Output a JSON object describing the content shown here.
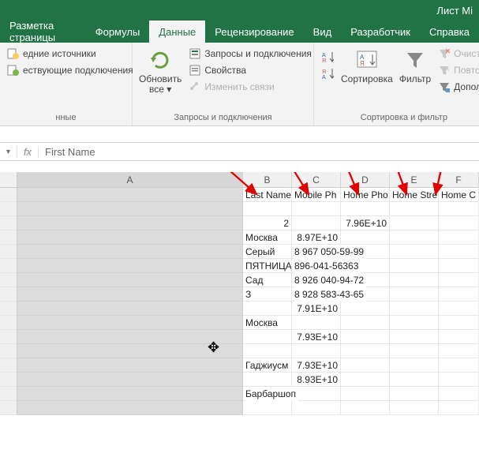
{
  "titlebar": {
    "filename": "Лист Mi"
  },
  "tabs": {
    "layout": "Разметка страницы",
    "formulas": "Формулы",
    "data": "Данные",
    "review": "Рецензирование",
    "view": "Вид",
    "developer": "Разработчик",
    "help": "Справка"
  },
  "ribbon": {
    "sources1": "едние источники",
    "sources2": "ествующие подключения",
    "sources_group": "нные",
    "refresh": "Обновить\nвсе ▾",
    "queries": "Запросы и подключения",
    "properties": "Свойства",
    "edit_links": "Изменить связи",
    "queries_group": "Запросы и подключения",
    "sort_az_tip": "А↓Я",
    "sort_za_tip": "Я↓А",
    "sort": "Сортировка",
    "filter": "Фильтр",
    "clear": "Очист",
    "reapply": "Повто",
    "advanced": "Дополн",
    "sort_group": "Сортировка и фильтр"
  },
  "formula_bar": {
    "fx": "fx",
    "value": "First Name"
  },
  "columns": {
    "A": "A",
    "B": "B",
    "C": "C",
    "D": "D",
    "E": "E",
    "F": "F"
  },
  "headers": {
    "B": "Last Name",
    "C": "Mobile Ph",
    "D": "Home Pho",
    "E": "Home Stre",
    "F": "Home C"
  },
  "rows": [
    {
      "B": "",
      "C": "",
      "D": "",
      "E": ""
    },
    {
      "B": "2",
      "Bnum": true,
      "C": "",
      "D": "7.96E+10",
      "Dnum": true,
      "E": ""
    },
    {
      "B": "Москва",
      "C": "8.97E+10",
      "Cnum": true,
      "D": "",
      "E": ""
    },
    {
      "B": "Серый",
      "C": "8 967 050-59-99",
      "Cover": true,
      "D": "",
      "E": ""
    },
    {
      "B": "ПЯТНИЦА",
      "C": "896-041-56363",
      "Cover": true,
      "D": "",
      "E": ""
    },
    {
      "B": "Сад",
      "C": "8 926 040-94-72",
      "Cover": true,
      "D": "",
      "E": ""
    },
    {
      "B": "З",
      "C": "8 928 583-43-65",
      "Cover": true,
      "D": "",
      "E": ""
    },
    {
      "B": "",
      "C": "7.91E+10",
      "Cnum": true,
      "D": "",
      "E": ""
    },
    {
      "B": "Москва",
      "C": "",
      "D": "",
      "E": ""
    },
    {
      "B": "",
      "C": "7.93E+10",
      "Cnum": true,
      "D": "",
      "E": ""
    },
    {
      "B": "",
      "C": "",
      "D": "",
      "E": ""
    },
    {
      "B": "Гаджиусм",
      "C": "7.93E+10",
      "Cnum": true,
      "D": "",
      "E": ""
    },
    {
      "B": "",
      "C": "8.93E+10",
      "Cnum": true,
      "D": "",
      "E": ""
    },
    {
      "B": "Барбаршоп",
      "Bover": true,
      "C": "",
      "D": "",
      "E": ""
    }
  ]
}
